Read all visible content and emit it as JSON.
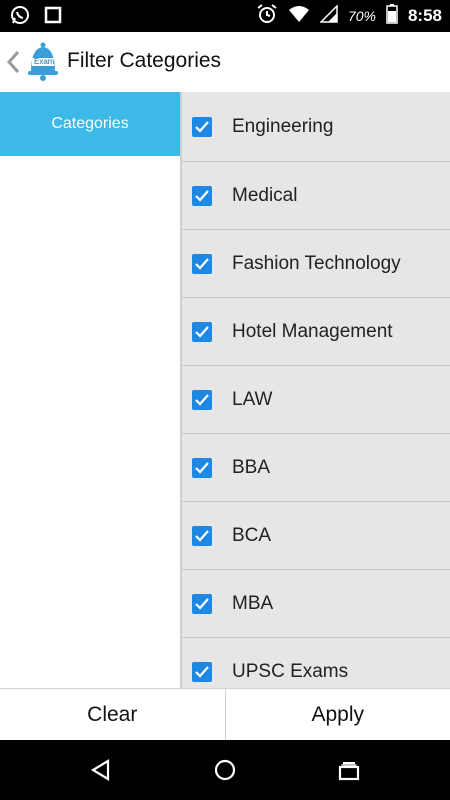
{
  "status_bar": {
    "battery": "70%",
    "time": "8:58",
    "icons": [
      "whatsapp-icon",
      "square-notification-icon",
      "alarm-icon",
      "wifi-icon",
      "signal-icon",
      "battery-icon"
    ]
  },
  "header": {
    "title": "Filter Categories",
    "logo_text": "Exam"
  },
  "sidebar": {
    "items": [
      {
        "label": "Categories",
        "active": true
      }
    ]
  },
  "categories": [
    {
      "label": "Engineering",
      "checked": true
    },
    {
      "label": "Medical",
      "checked": true
    },
    {
      "label": "Fashion Technology",
      "checked": true
    },
    {
      "label": "Hotel Management",
      "checked": true
    },
    {
      "label": "LAW",
      "checked": true
    },
    {
      "label": "BBA",
      "checked": true
    },
    {
      "label": "BCA",
      "checked": true
    },
    {
      "label": "MBA",
      "checked": true
    },
    {
      "label": "UPSC Exams",
      "checked": true
    }
  ],
  "footer": {
    "clear_label": "Clear",
    "apply_label": "Apply"
  },
  "colors": {
    "accent": "#3cb9e6",
    "checkbox": "#1e88e5",
    "list_bg": "#e6e6e6"
  }
}
